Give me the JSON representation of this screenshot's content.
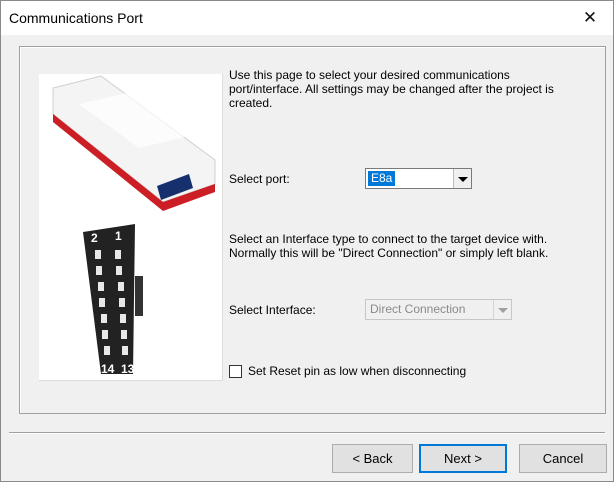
{
  "window": {
    "title": "Communications Port",
    "close_glyph": "✕"
  },
  "intro_text": "Use this page to select your desired communications port/interface. All settings may be changed after the project is created.",
  "port": {
    "label": "Select port:",
    "value": "E8a"
  },
  "interface_help": "Select an Interface type to connect to the target device with. Normally this will be \"Direct Connection\" or simply left blank.",
  "interface": {
    "label": "Select Interface:",
    "value": "Direct Connection",
    "disabled": true
  },
  "reset_option": {
    "label": "Set Reset pin as low when disconnecting",
    "checked": false
  },
  "device_image": {
    "pin_labels_top": [
      "2",
      "1"
    ],
    "pin_labels_bottom": [
      "14",
      "13"
    ]
  },
  "buttons": {
    "back": "< Back",
    "next": "Next >",
    "cancel": "Cancel"
  },
  "colors": {
    "selection": "#0078d7",
    "device_red": "#cc1f25",
    "connector_dark": "#222222"
  }
}
